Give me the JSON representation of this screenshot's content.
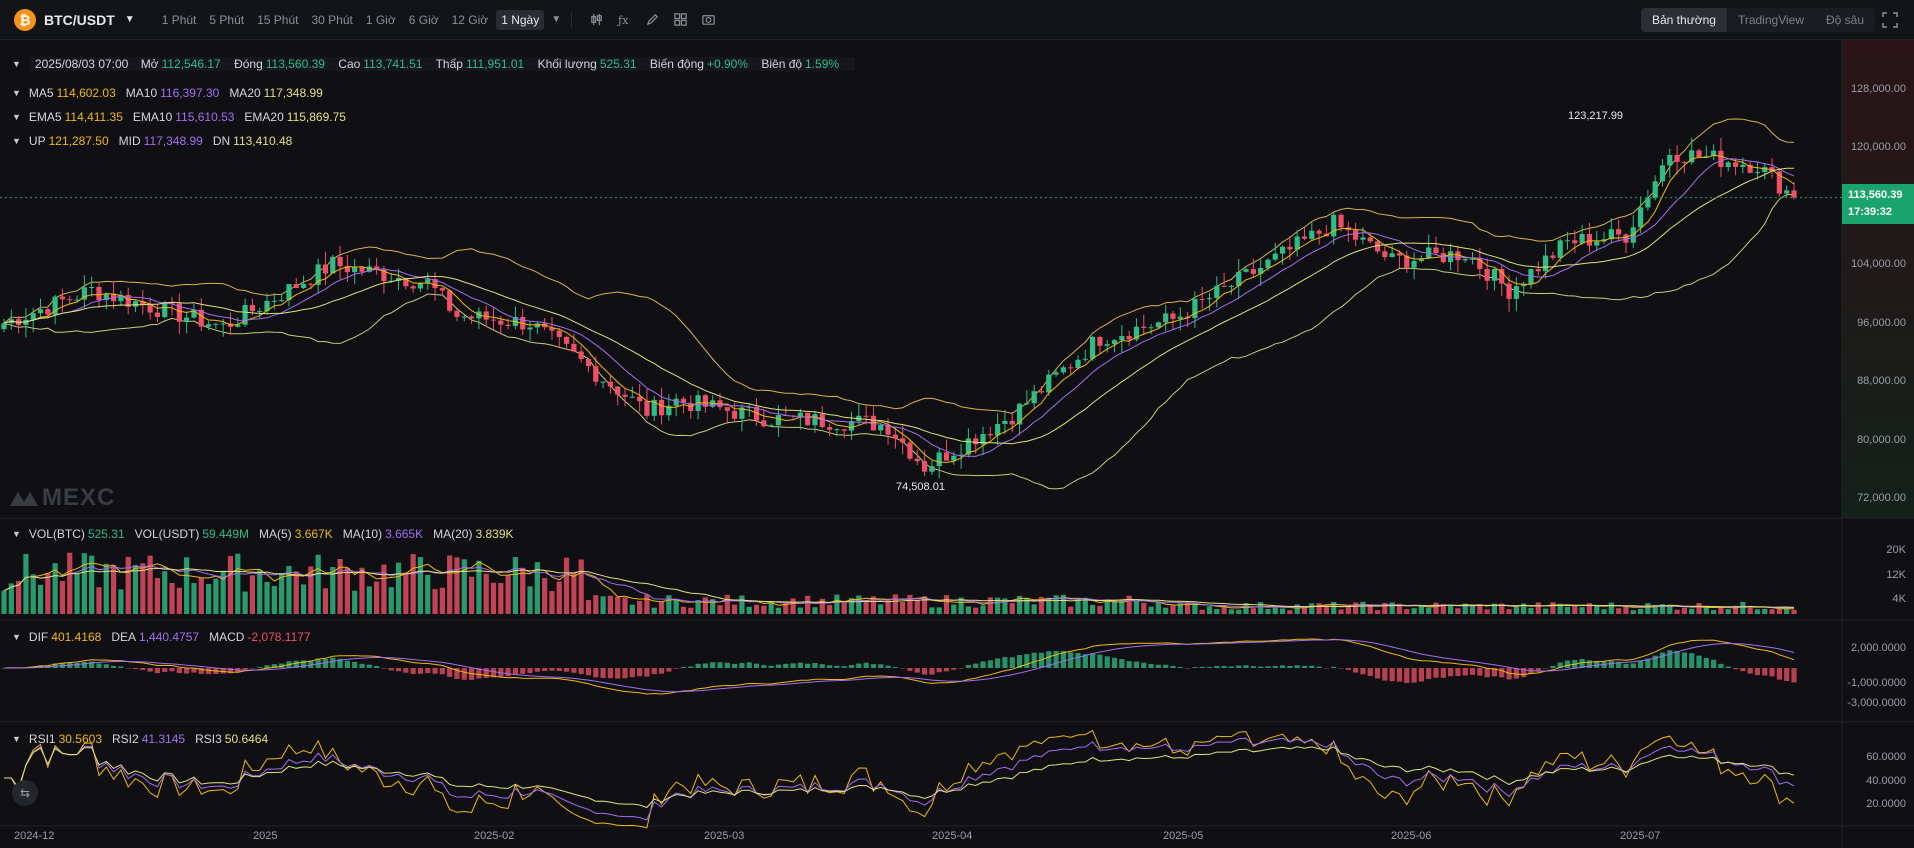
{
  "toolbar": {
    "coin_icon_glyph": "₿",
    "pair": "BTC/USDT",
    "intervals": [
      "1 Phút",
      "5 Phút",
      "15 Phút",
      "30 Phút",
      "1 Giờ",
      "6 Giờ",
      "12 Giờ",
      "1 Ngày"
    ],
    "active_interval": "1 Ngày",
    "views": [
      "Bản thường",
      "TradingView",
      "Độ sâu"
    ],
    "active_view": "Bản thường"
  },
  "legend": {
    "ohlc": {
      "date": "2025/08/03 07:00",
      "open_label": "Mở",
      "open": "112,546.17",
      "close_label": "Đóng",
      "close": "113,560.39",
      "high_label": "Cao",
      "high": "113,741.51",
      "low_label": "Thấp",
      "low": "111,951.01",
      "vol_label": "Khối lượng",
      "vol": "525.31",
      "chg_label": "Biến động",
      "chg": "+0.90%",
      "amp_label": "Biên độ",
      "amp": "1.59%"
    },
    "ma": {
      "ma5_label": "MA5",
      "ma5": "114,602.03",
      "ma10_label": "MA10",
      "ma10": "116,397.30",
      "ma20_label": "MA20",
      "ma20": "117,348.99"
    },
    "ema": {
      "ema5_label": "EMA5",
      "ema5": "114,411.35",
      "ema10_label": "EMA10",
      "ema10": "115,610.53",
      "ema20_label": "EMA20",
      "ema20": "115,869.75"
    },
    "boll": {
      "up_label": "UP",
      "up": "121,287.50",
      "mid_label": "MID",
      "mid": "117,348.99",
      "dn_label": "DN",
      "dn": "113,410.48"
    },
    "vol": {
      "btc_label": "VOL(BTC)",
      "btc": "525.31",
      "usdt_label": "VOL(USDT)",
      "usdt": "59.449M",
      "ma5_label": "MA(5)",
      "ma5": "3.667K",
      "ma10_label": "MA(10)",
      "ma10": "3.665K",
      "ma20_label": "MA(20)",
      "ma20": "3.839K"
    },
    "macd": {
      "dif_label": "DIF",
      "dif": "401.4168",
      "dea_label": "DEA",
      "dea": "1,440.4757",
      "macd_label": "MACD",
      "macd": "-2,078.1177"
    },
    "rsi": {
      "rsi1_label": "RSI1",
      "rsi1": "30.5603",
      "rsi2_label": "RSI2",
      "rsi2": "41.3145",
      "rsi3_label": "RSI3",
      "rsi3": "50.6464"
    }
  },
  "price_axis": [
    "128,000.00",
    "120,000.00",
    "112,000.00",
    "104,000.00",
    "96,000.00",
    "88,000.00",
    "80,000.00",
    "72,000.00"
  ],
  "current_price": {
    "value": "113,560.39",
    "countdown": "17:39:32"
  },
  "annotations": {
    "high": "123,217.99",
    "low": "74,508.01"
  },
  "volume_axis": [
    "20K",
    "12K",
    "4K"
  ],
  "macd_axis": [
    "2,000.0000",
    "-1,000.0000",
    "-3,000.0000"
  ],
  "rsi_axis": [
    "60.0000",
    "40.0000",
    "20.0000"
  ],
  "time_axis": [
    "2024-12",
    "2025",
    "2025-02",
    "2025-03",
    "2025-04",
    "2025-05",
    "2025-06",
    "2025-07"
  ],
  "watermark": "MEXC",
  "colors": {
    "up": "#2fbd85",
    "down": "#ef5066",
    "ma5": "#f0b90b",
    "ma10": "#a36ef0",
    "ma20": "#dfe27a",
    "boll": "#d9b24c"
  },
  "chart_data": {
    "type": "candlestick",
    "title": "BTC/USDT 1 Ngày",
    "ylim": [
      70000,
      132000
    ],
    "x_labels": [
      "2024-12",
      "2025",
      "2025-02",
      "2025-03",
      "2025-04",
      "2025-05",
      "2025-06",
      "2025-07"
    ],
    "close_path": [
      [
        "2024-12",
        96500
      ],
      [
        "2024-12-mid",
        101000
      ],
      [
        "2025",
        96000
      ],
      [
        "2025-01-mid",
        104500
      ],
      [
        "2025-01-end",
        102000
      ],
      [
        "2025-02",
        97500
      ],
      [
        "2025-02-mid",
        96500
      ],
      [
        "2025-02-end",
        84500
      ],
      [
        "2025-03",
        86000
      ],
      [
        "2025-03-mid",
        83500
      ],
      [
        "2025-03-end",
        83000
      ],
      [
        "2025-04",
        82500
      ],
      [
        "2025-04-07",
        77000
      ],
      [
        "2025-04-mid",
        84000
      ],
      [
        "2025-04-end",
        94500
      ],
      [
        "2025-05",
        97000
      ],
      [
        "2025-05-mid",
        104000
      ],
      [
        "2025-05-22",
        110000
      ],
      [
        "2025-06",
        105000
      ],
      [
        "2025-06-mid",
        106000
      ],
      [
        "2025-06-22",
        101000
      ],
      [
        "2025-06-end",
        107500
      ],
      [
        "2025-07",
        108500
      ],
      [
        "2025-07-14",
        119800
      ],
      [
        "2025-07-end",
        118000
      ],
      [
        "2025-08-03",
        113560
      ]
    ],
    "extremes": {
      "high": 123217.99,
      "low": 74508.01
    }
  }
}
